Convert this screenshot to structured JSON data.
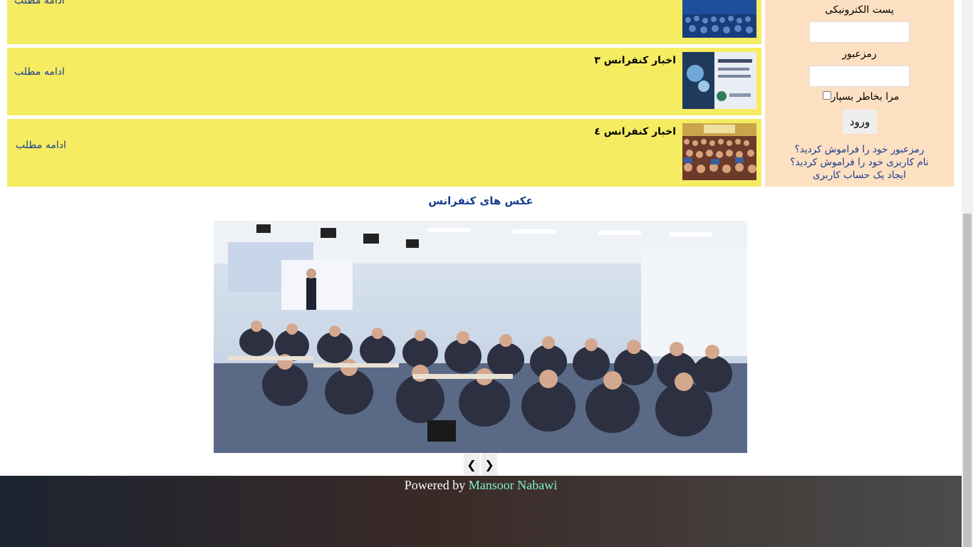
{
  "news": [
    {
      "title": "",
      "more_label": "ادامه مطلب"
    },
    {
      "title": "اخبار کنفرانس ٣",
      "more_label": "ادامه مطلب"
    },
    {
      "title": "اخبار کنفرانس ٤",
      "more_label": "ادامه مطلب"
    }
  ],
  "login": {
    "email_label": "پست الکترونیکی",
    "password_label": "رمزعبور",
    "remember_label": "مرا بخاطر بسپار",
    "submit_label": "ورود",
    "forgot_password": "رمزعبور خود را فراموش کردید؟",
    "forgot_username": "نام کاربری خود را فراموش کردید؟",
    "create_account": "ایجاد یک حساب کاربری"
  },
  "gallery": {
    "title": "عکس های کنفرانس",
    "prev_label": "❮",
    "next_label": "❯"
  },
  "footer": {
    "prefix": "Powered by",
    "author": "Mansoor Nabawi"
  },
  "colors": {
    "news_bg": "#f6ec62",
    "login_bg": "#fde0c2",
    "link": "#1a3c8f",
    "footer_author": "#7ef2c5"
  }
}
